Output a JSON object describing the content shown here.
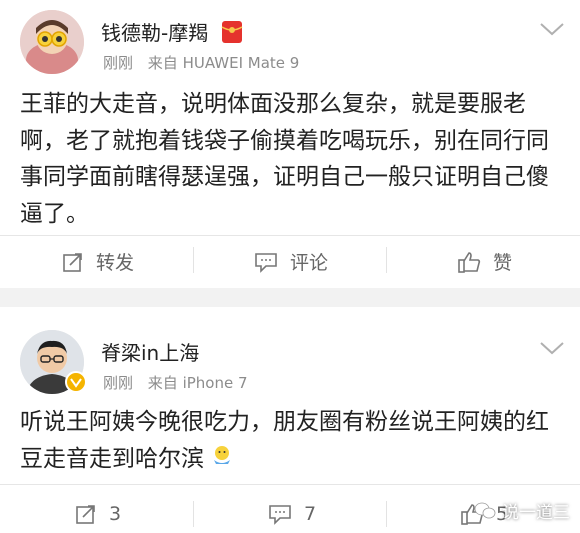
{
  "posts": [
    {
      "author": "钱德勒-摩羯",
      "time": "刚刚",
      "source": "来自 HUAWEI Mate 9",
      "body": "王菲的大走音，说明体面没那么复杂，就是要服老啊，老了就抱着钱袋子偷摸着吃喝玩乐，别在同行同事同学面前瞎得瑟逞强，证明自己一般只证明自己傻逼了。",
      "actions": {
        "repost": "转发",
        "comment": "评论",
        "like": "赞"
      }
    },
    {
      "author": "脊梁in上海",
      "time": "刚刚",
      "source": "来自 iPhone 7",
      "body": "听说王阿姨今晚很吃力，朋友圈有粉丝说王阿姨的红豆走音走到哈尔滨",
      "actions": {
        "repost": "3",
        "comment": "7",
        "like": "5"
      }
    }
  ],
  "watermark": "说一道三",
  "icons": [
    "red-packet-icon",
    "verified-badge-icon",
    "chevron-down-icon",
    "repost-icon",
    "comment-icon",
    "like-icon",
    "emoji-icon",
    "wechat-icon"
  ],
  "colors": {
    "text": "#222222",
    "meta": "#8c8c8c",
    "action": "#666666",
    "badge": "#f5b400",
    "redpacket": "#e5322d"
  }
}
